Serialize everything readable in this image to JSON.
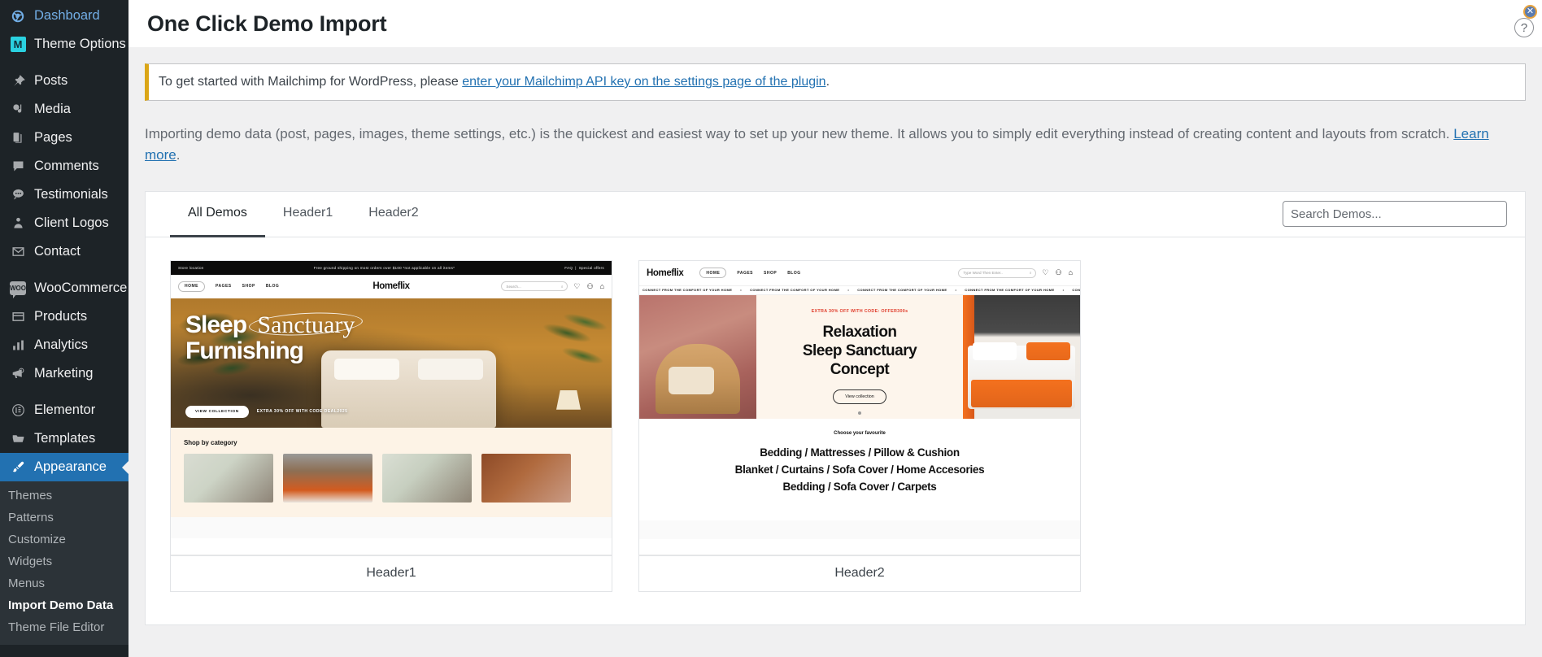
{
  "sidebar": {
    "items": [
      {
        "label": "Dashboard",
        "icon": "dashboard-icon",
        "state": "link"
      },
      {
        "label": "Theme Options",
        "icon": "theme-options-icon",
        "state": "normal"
      },
      {
        "label": "Posts",
        "icon": "pin-icon",
        "state": "normal"
      },
      {
        "label": "Media",
        "icon": "media-icon",
        "state": "normal"
      },
      {
        "label": "Pages",
        "icon": "pages-icon",
        "state": "normal"
      },
      {
        "label": "Comments",
        "icon": "comments-icon",
        "state": "normal"
      },
      {
        "label": "Testimonials",
        "icon": "testimonials-icon",
        "state": "normal"
      },
      {
        "label": "Client Logos",
        "icon": "user-badge-icon",
        "state": "normal"
      },
      {
        "label": "Contact",
        "icon": "envelope-icon",
        "state": "normal"
      },
      {
        "label": "WooCommerce",
        "icon": "woocommerce-icon",
        "state": "normal"
      },
      {
        "label": "Products",
        "icon": "products-icon",
        "state": "normal"
      },
      {
        "label": "Analytics",
        "icon": "analytics-icon",
        "state": "normal"
      },
      {
        "label": "Marketing",
        "icon": "megaphone-icon",
        "state": "normal"
      },
      {
        "label": "Elementor",
        "icon": "elementor-icon",
        "state": "normal"
      },
      {
        "label": "Templates",
        "icon": "folder-icon",
        "state": "normal"
      },
      {
        "label": "Appearance",
        "icon": "brush-icon",
        "state": "current"
      }
    ],
    "submenu": [
      {
        "label": "Themes",
        "active": false
      },
      {
        "label": "Patterns",
        "active": false
      },
      {
        "label": "Customize",
        "active": false
      },
      {
        "label": "Widgets",
        "active": false
      },
      {
        "label": "Menus",
        "active": false
      },
      {
        "label": "Import Demo Data",
        "active": true
      },
      {
        "label": "Theme File Editor",
        "active": false
      }
    ]
  },
  "header": {
    "title": "One Click Demo Import",
    "help_icon": "?",
    "close_icon": "✕"
  },
  "notice": {
    "text_before": "To get started with Mailchimp for WordPress, please ",
    "link_text": "enter your Mailchimp API key on the settings page of the plugin",
    "text_after": ".",
    "accent_color": "#dba617"
  },
  "intro": {
    "text_before": "Importing demo data (post, pages, images, theme settings, etc.) is the quickest and easiest way to set up your new theme. It allows you to simply edit everything instead of creating content and layouts from scratch. ",
    "link_text": "Learn more",
    "text_after": "."
  },
  "panel": {
    "tabs": [
      {
        "label": "All Demos",
        "active": true
      },
      {
        "label": "Header1",
        "active": false
      },
      {
        "label": "Header2",
        "active": false
      }
    ],
    "search": {
      "value": "",
      "placeholder": "Search Demos..."
    }
  },
  "demos": [
    {
      "name": "Header1",
      "preview": {
        "topstrip_left": "Store location",
        "topstrip_center": "Free ground shipping on most orders over $100 *not applicable on all items*",
        "topstrip_right_1": "FAQ",
        "topstrip_right_2": "Special offers",
        "logo": "Homeflix",
        "nav": [
          "HOME",
          "PAGES",
          "SHOP",
          "BLOG"
        ],
        "search_placeholder": "Search...",
        "hero_line1_a": "Sleep",
        "hero_line1_b": "Sanctuary",
        "hero_line2": "Furnishing",
        "hero_button": "VIEW COLLECTION",
        "hero_code": "EXTRA 30% OFF WITH CODE DEAL2025",
        "section_title": "Shop by category"
      }
    },
    {
      "name": "Header2",
      "preview": {
        "logo": "Homeflix",
        "nav": [
          "HOME",
          "PAGES",
          "SHOP",
          "BLOG"
        ],
        "search_placeholder": "Type Word Then Enter..",
        "marquee_text": "CONNECT FROM THE COMFORT OF YOUR HOME",
        "hero_code_before": "EXTRA 30% OFF  WITH CODE: ",
        "hero_code_highlight": "OFFER300s",
        "hero_title_1": "Relaxation",
        "hero_title_2": "Sleep Sanctuary",
        "hero_title_3": "Concept",
        "hero_button": "View collection",
        "fav_kicker": "Choose your favourite",
        "fav_line1": "Bedding / Mattresses / Pillow & Cushion",
        "fav_line2": "Blanket / Curtains / Sofa Cover / Home Accesories",
        "fav_line3": "Bedding / Sofa Cover / Carpets"
      }
    }
  ]
}
